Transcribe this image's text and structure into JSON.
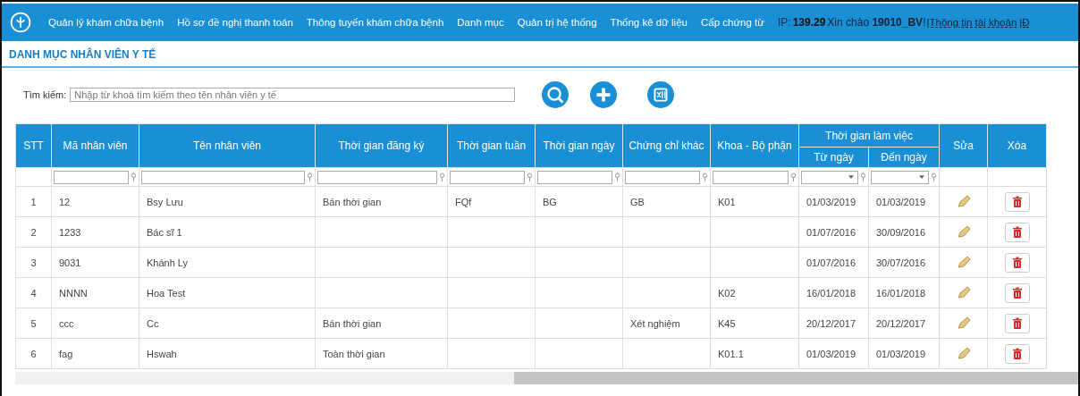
{
  "nav": {
    "items": [
      "Quản lý khám chữa bệnh",
      "Hồ sơ đề nghị thanh toán",
      "Thông tuyến khám chữa bệnh",
      "Danh mục",
      "Quản trị hệ thống",
      "Thống kê dữ liệu",
      "Cấp chứng từ"
    ],
    "ip_label": "IP:",
    "ip": "139.29",
    "greeting": "Xin chào **19010_BV**!",
    "account_link": "|Thông tin tài khoản",
    "cut_link": "|Đ"
  },
  "page_title": "DANH MỤC NHÂN VIÊN Y TẾ",
  "search": {
    "label": "Tìm kiếm:",
    "placeholder": "Nhập từ khoá tìm kiếm theo tên nhân viên y tế"
  },
  "table": {
    "columns": [
      {
        "label": "STT"
      },
      {
        "label": "Mã nhân viên"
      },
      {
        "label": "Tên nhân viên"
      },
      {
        "label": "Thời gian đăng ký"
      },
      {
        "label": "Thời gian tuần"
      },
      {
        "label": "Thời gian ngày"
      },
      {
        "label": "Chứng chỉ khác"
      },
      {
        "label": "Khoa - Bộ phận"
      },
      {
        "label": "Từ ngày",
        "grouped": true
      },
      {
        "label": "Đến ngày",
        "grouped": true
      },
      {
        "label": "Sửa"
      },
      {
        "label": "Xóa"
      }
    ],
    "group_header": "Thời gian làm việc",
    "rows": [
      {
        "cells": [
          "1",
          "12",
          "Bsy Lưu",
          "Bán thời gian",
          "FQf",
          "BG",
          "GB",
          "K01",
          "01/03/2019",
          "01/03/2019"
        ]
      },
      {
        "cells": [
          "2",
          "1233",
          "Bác sĩ 1",
          "",
          "",
          "",
          "",
          "",
          "01/07/2016",
          "30/09/2016"
        ]
      },
      {
        "cells": [
          "3",
          "9031",
          "Khánh Ly",
          "",
          "",
          "",
          "",
          "",
          "01/07/2016",
          "30/07/2016"
        ]
      },
      {
        "cells": [
          "4",
          "NNNN",
          "Hoa Test",
          "",
          "",
          "",
          "",
          "K02",
          "16/01/2018",
          "16/01/2018"
        ]
      },
      {
        "cells": [
          "5",
          "ccc",
          "Cc",
          "Bán thời gian",
          "",
          "",
          "Xét nghiệm",
          "K45",
          "20/12/2017",
          "20/12/2017"
        ]
      },
      {
        "cells": [
          "6",
          "fag",
          "Hswah",
          "Toàn thời gian",
          "",
          "",
          "",
          "K01.1",
          "01/03/2019",
          "01/03/2019"
        ]
      }
    ]
  }
}
